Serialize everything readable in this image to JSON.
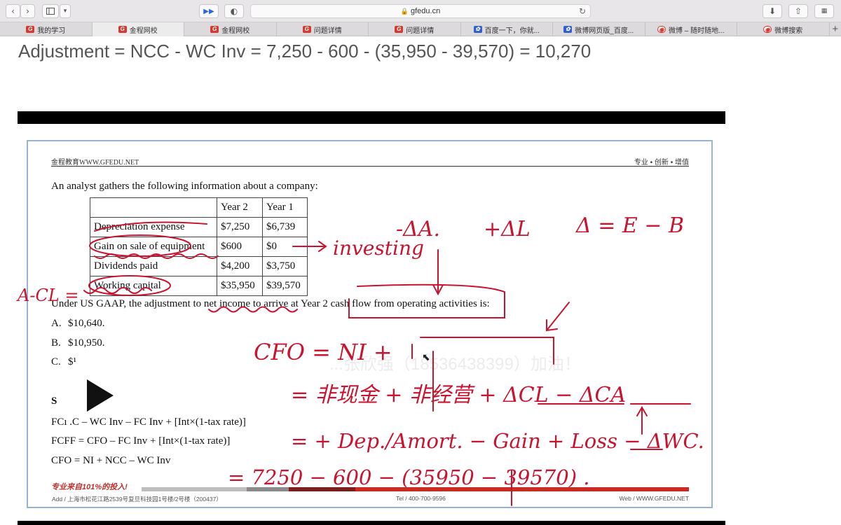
{
  "browser": {
    "url": "gfedu.cn",
    "tabs": [
      {
        "label": "我的学习",
        "icon": "g",
        "active": false
      },
      {
        "label": "金程网校",
        "icon": "g",
        "active": true
      },
      {
        "label": "金程网校",
        "icon": "g",
        "active": false
      },
      {
        "label": "问题详情",
        "icon": "g",
        "active": false
      },
      {
        "label": "问题详情",
        "icon": "g",
        "active": false
      },
      {
        "label": "百度一下，你就...",
        "icon": "b",
        "active": false
      },
      {
        "label": "微博网页版_百度...",
        "icon": "b",
        "active": false
      },
      {
        "label": "微博 – 随时随地...",
        "icon": "w",
        "active": false
      },
      {
        "label": "微博搜索",
        "icon": "w",
        "active": false
      }
    ]
  },
  "page": {
    "heading": "Adjustment = NCC - WC Inv = 7,250 - 600 - (35,950 - 39,570) = 10,270"
  },
  "slide": {
    "header_left": "金程教育WWW.GFEDU.NET",
    "header_right": "专业 • 创新 • 增值",
    "intro": "An analyst gathers the following information about a company:",
    "table": {
      "headers": [
        "",
        "Year 2",
        "Year 1"
      ],
      "rows": [
        [
          "Depreciation expense",
          "$7,250",
          "$6,739"
        ],
        [
          "Gain on sale of equipment",
          "$600",
          "$0"
        ],
        [
          "Dividends paid",
          "$4,200",
          "$3,750"
        ],
        [
          "Working capital",
          "$35,950",
          "$39,570"
        ]
      ]
    },
    "question": "Under US GAAP, the adjustment to net income to arrive at Year 2 cash flow from operating activities is:",
    "options": [
      {
        "letter": "A.",
        "text": "$10,640."
      },
      {
        "letter": "B.",
        "text": "$10,950."
      },
      {
        "letter": "C.",
        "text": "$¹"
      }
    ],
    "solution_label": "S",
    "solution_lines": [
      "FCı                 .C – WC Inv – FC Inv + [Int×(1-tax rate)]",
      "FCFF = CFO – FC Inv + [Int×(1-tax rate)]",
      "CFO = NI + NCC – WC Inv"
    ],
    "footer_handwriting": "专业来自101%的投入!",
    "footer_addr": "Add / 上海市松花江路2539号复旦科技园1号楼/2号楼（200437）",
    "footer_tel": "Tel / 400-700-9596",
    "footer_web": "Web / WWW.GFEDU.NET",
    "watermark": "...张欣强（18536438399）加油！"
  },
  "annotations": {
    "ink_color": "#c8142f",
    "delta_a": "-ΔA.",
    "delta_l": "+ΔL",
    "delta_eq": "Δ = E − B",
    "investing": "investing",
    "wc_def": "A-CL =",
    "cfo_line": "CFO = NI  +",
    "cash_line": "= 非现金 + 非经营 + ΔCL − ΔCA",
    "dep_line": "= + Dep./Amort. − Gain + Loss − ΔWC.",
    "num_line": "= 7250 − 600 − (35950 − 39570) ."
  }
}
